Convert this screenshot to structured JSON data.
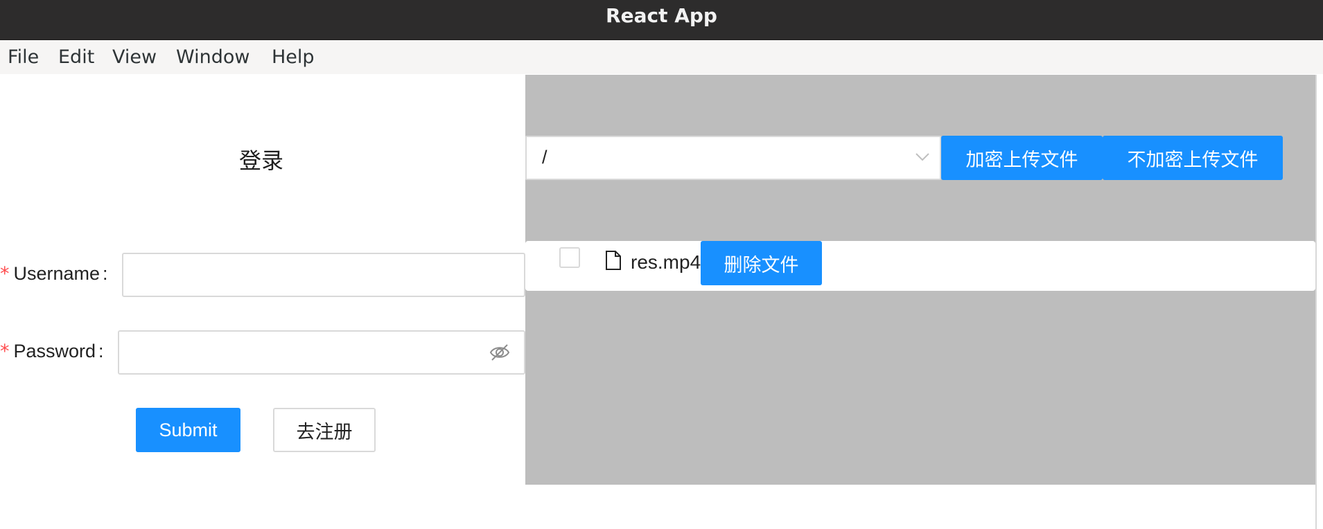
{
  "window": {
    "title": "React App"
  },
  "menu": {
    "items": [
      "File",
      "Edit",
      "View",
      "Window",
      "Help"
    ]
  },
  "login": {
    "title": "登录",
    "username_label": "Username",
    "password_label": "Password",
    "required_mark": "*",
    "colon": ":",
    "username_value": "",
    "password_value": "",
    "submit_label": "Submit",
    "register_label": "去注册"
  },
  "files": {
    "path_value": "/",
    "encrypt_upload_label": "加密上传文件",
    "plain_upload_label": "不加密上传文件",
    "items": [
      {
        "name": "res.mp4",
        "checked": false,
        "delete_label": "删除文件"
      }
    ]
  },
  "colors": {
    "primary": "#1890ff",
    "panel_bg": "#bdbdbd",
    "required": "#ff4d4f",
    "titlebar": "#2d2c2c"
  },
  "icons": {
    "password_toggle": "eye-invisible-icon",
    "select_arrow": "chevron-down-icon",
    "file": "file-icon"
  }
}
